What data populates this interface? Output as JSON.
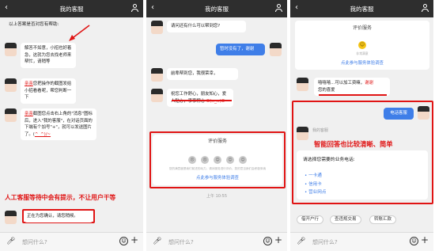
{
  "header": {
    "title": "我的客服"
  },
  "footer": {
    "placeholder": "想问什么?"
  },
  "p1": {
    "top_text": "以上答案是否对您有帮助:",
    "msg1": "解答不如意，小招也好着急，这就为您去找老师来帮忙，请稍等",
    "msg2_a": "亲亲",
    "msg2_b": "您把操作的截图发给小招看看呢，帮您判断一下",
    "msg3_a": "亲亲",
    "msg3_b": "截图您点击右上角的\"消息\"图标后，进入\"我的客服\"，在对话页面的下端有个加号\"+\"，就可以发送图片了。(",
    "msg3_c": "^_^)/~",
    "msg4": "正在为您确认，请您稍候。",
    "annotation": "人工客服等待中会有提示，不让用户干等"
  },
  "p2": {
    "msg1": "请问还有什么可以帮到您?",
    "user_msg": "暂时没有了，谢谢",
    "msg2": "前辈帮到您，我很荣幸，",
    "msg3_a": "祝您工作舒心，朋友知心，爱人贴心，事事称心",
    "msg3_b": "O(∩_∩)O~",
    "rating_title": "评价服务",
    "rating_small": "您的满意度是我们前进的动力，请对服务进行评价，您的意见我们会积极采纳",
    "rating_link": "点此参与服务体验调查",
    "time": "上午 10:55"
  },
  "p3": {
    "rating_title": "评价服务",
    "rating_small": "非常满意",
    "rating_link": "点此参与服务体验调查",
    "msg1_a": "嘻嘻嘻...可以加工资嘛，",
    "msg1_b": "谢谢",
    "msg1_c": "您的喜爱",
    "user_msg": "电话客服",
    "sender": "我的客服",
    "annotation": "智能回答也比较清晰、简单",
    "prompt": "请选择您需要的业务电话:",
    "options": [
      "一卡通",
      "信用卡",
      "营业网点"
    ],
    "quick": [
      "借开户行",
      "查违规交易",
      "转账汇款"
    ]
  },
  "colors": {
    "accent": "#e01414",
    "link": "#3f7ee8",
    "header": "#2e2e2e"
  },
  "icons": [
    "back-arrow-icon",
    "user-icon",
    "mic-icon",
    "emoji-icon",
    "plus-icon",
    "face-rating-icon"
  ]
}
